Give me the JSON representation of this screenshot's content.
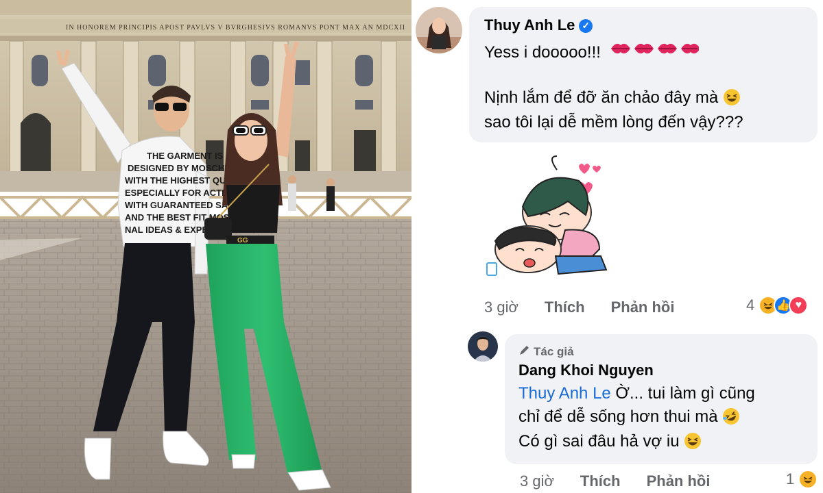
{
  "photo": {
    "inscription": "IN HONOREM PRINCIPIS APOST PAVLVS V BVRGHESIVS ROMANVS PONT MAX AN MDCXII",
    "shirt_lines": [
      "THE GARMENT IS",
      "DESIGNED BY MOSCHINO",
      "WITH THE HIGHEST QUALITY",
      "ESPECIALLY FOR ACTIVE",
      "WITH GUARANTEED SATISF",
      "AND THE BEST FIT MOSCH",
      "NAL IDEAS & EXPER"
    ],
    "belt_buckle": "GG"
  },
  "comment1": {
    "author": "Thuy Anh Le",
    "verified": true,
    "line1": "Yess i dooooo!!!",
    "line2": "Nịnh lắm để đỡ ăn chảo đây mà",
    "line3": "sao tôi lại dễ mềm lòng đến vậy???",
    "time": "3 giờ",
    "like_label": "Thích",
    "reply_label": "Phản hồi",
    "reaction_count": "4"
  },
  "comment2": {
    "badge": "Tác giả",
    "author": "Dang Khoi Nguyen",
    "mention": "Thuy Anh Le",
    "line1_rest": " Ờ... tui làm gì cũng",
    "line2": "chỉ để dễ sống hơn thui mà",
    "line3": "Có gì sai đâu hả vợ iu",
    "time": "3 giờ",
    "like_label": "Thích",
    "reply_label": "Phản hồi",
    "reaction_count": "1"
  },
  "colors": {
    "bubble": "#f0f2f5",
    "link": "#1a6bd6",
    "meta": "#65676b",
    "like_blue": "#1877f2",
    "love_red": "#f33e58",
    "haha_yellow": "#f7b125"
  },
  "icons": [
    "verified-icon",
    "kiss-mark-icon",
    "grinning-squint-icon",
    "rolling-laughing-icon",
    "pencil-icon",
    "like-icon",
    "love-icon",
    "haha-icon",
    "sticker-icon"
  ]
}
